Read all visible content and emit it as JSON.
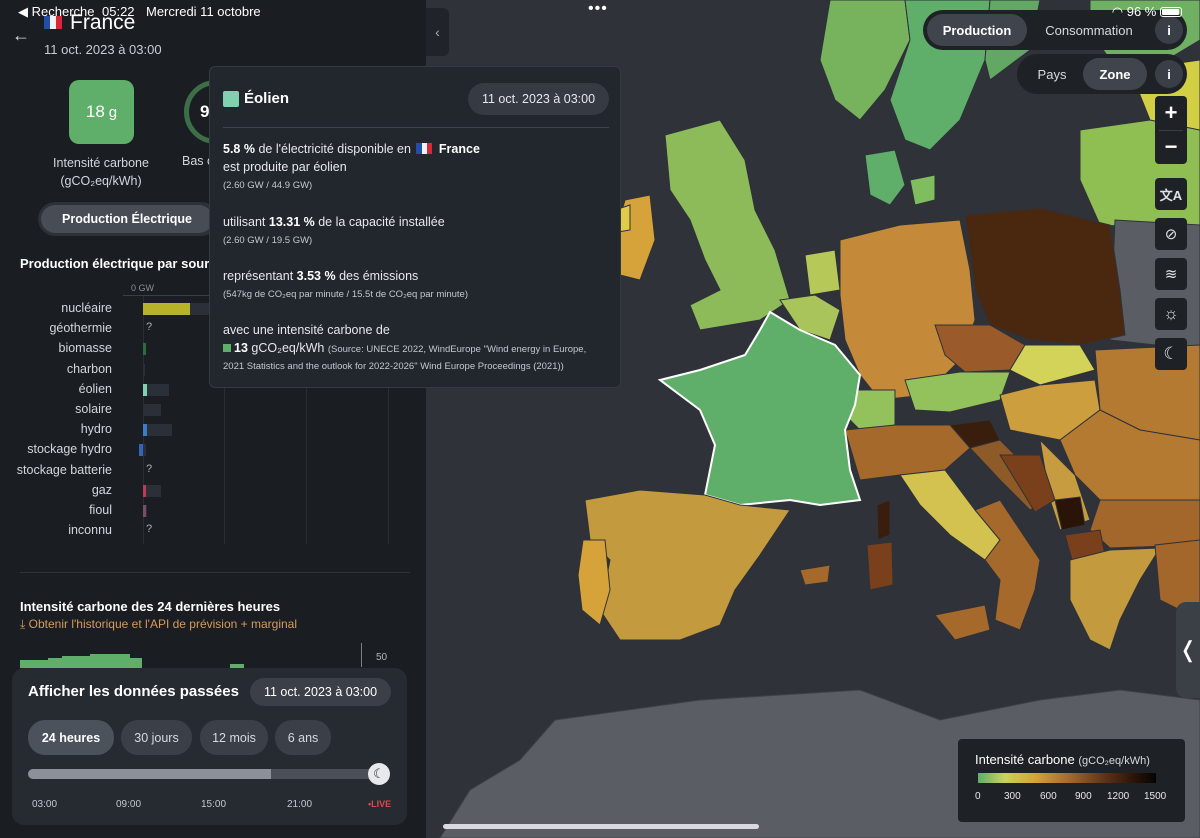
{
  "status_bar": {
    "back_app": "◀ Recherche",
    "time": "05:22",
    "date": "Mercredi 11 octobre",
    "battery": "96 %"
  },
  "panel": {
    "zone_name": "France",
    "zone_datetime": "11 oct. 2023 à 03:00",
    "carbon_intensity": {
      "value": "18",
      "unit": "g",
      "label_line1": "Intensité carbone",
      "label_line2": "(gCO₂eq/kWh)"
    },
    "low_carbon": {
      "value": "9",
      "label": "Bas c"
    },
    "mode_toggle_label": "Production Électrique",
    "production_title": "Production électrique par sour",
    "axis_zero": "0 GW",
    "sources": [
      {
        "name": "nucléaire",
        "value_gw": 35.0,
        "capacity_gw": 61.4,
        "color": "#b6b32b"
      },
      {
        "name": "géothermie",
        "value_gw": null,
        "capacity_gw": null,
        "color": "",
        "unknown": "?"
      },
      {
        "name": "biomasse",
        "value_gw": 0.9,
        "capacity_gw": 2.2,
        "color": "#2f6b3a"
      },
      {
        "name": "charbon",
        "value_gw": 0,
        "capacity_gw": 1.8,
        "color": "#555555"
      },
      {
        "name": "éolien",
        "value_gw": 2.6,
        "capacity_gw": 19.5,
        "color": "#7fd1b0"
      },
      {
        "name": "solaire",
        "value_gw": 0,
        "capacity_gw": 13.7,
        "color": "#e5c53b"
      },
      {
        "name": "hydro",
        "value_gw": 3.0,
        "capacity_gw": 21.5,
        "color": "#3b7cc7"
      },
      {
        "name": "stockage hydro",
        "value_gw": -1.5,
        "capacity_gw": 5.0,
        "color": "#3264b8"
      },
      {
        "name": "stockage batterie",
        "value_gw": null,
        "capacity_gw": null,
        "color": "",
        "unknown": "?"
      },
      {
        "name": "gaz",
        "value_gw": 0.6,
        "capacity_gw": 13.0,
        "color": "#c23a4f"
      },
      {
        "name": "fioul",
        "value_gw": 0.2,
        "capacity_gw": 2.9,
        "color": "#7a4c6b"
      },
      {
        "name": "inconnu",
        "value_gw": null,
        "capacity_gw": null,
        "color": "",
        "unknown": "?"
      }
    ],
    "history_title": "Intensité carbone des 24 dernières heures",
    "history_link": "⤓ Obtenir l'historique et l'API de prévision + marginal",
    "history_axis_value": "50"
  },
  "time_controller": {
    "title": "Afficher les données passées",
    "selected_datetime": "11 oct. 2023 à 03:00",
    "ranges": [
      "24 heures",
      "30 jours",
      "12 mois",
      "6 ans"
    ],
    "active_range": "24 heures",
    "progress": 0.7,
    "ticks": [
      "03:00",
      "09:00",
      "15:00",
      "21:00"
    ],
    "live_label": "•LIVE"
  },
  "tooltip": {
    "title": "Éolien",
    "datetime": "11 oct. 2023 à 03:00",
    "p1_pct": "5.8 %",
    "p1_text_a": "de l'électricité disponible en",
    "p1_country": "France",
    "p1_text_b": "est produite par éolien",
    "p1_small": "(2.60 GW / 44.9 GW)",
    "p2_text_a": "utilisant",
    "p2_pct": "13.31 %",
    "p2_text_b": "de la capacité installée",
    "p2_small": "(2.60 GW / 19.5 GW)",
    "p3_text_a": "représentant",
    "p3_pct": "3.53 %",
    "p3_text_b": "des émissions",
    "p3_small": "(547kg de CO₂eq par minute / 15.5t de CO₂eq par minute)",
    "p4_text": "avec une intensité carbone de",
    "p4_value": "13",
    "p4_unit": "gCO₂eq/kWh",
    "p4_source_a": "(Source: UNECE 2022, WindEurope \"Wind energy in Europe,",
    "p4_source_b": "2021 Statistics and the outlook for 2022-2026\" Wind Europe Proceedings (2021))"
  },
  "map_controls": {
    "view_modes": [
      "Production",
      "Consommation"
    ],
    "active_view_mode": "Production",
    "granularity": [
      "Pays",
      "Zone"
    ],
    "active_granularity": "Zone",
    "info_label": "i",
    "zoom_in": "+",
    "zoom_out": "−",
    "layer_buttons": [
      {
        "name": "language-icon",
        "glyph": "文A"
      },
      {
        "name": "eye-off-icon",
        "glyph": "⊘"
      },
      {
        "name": "wind-icon",
        "glyph": "≋"
      },
      {
        "name": "sun-icon",
        "glyph": "☼"
      },
      {
        "name": "moon-icon",
        "glyph": "☾"
      }
    ],
    "side_handle": "❬"
  },
  "legend": {
    "title": "Intensité carbone",
    "unit": "(gCO₂eq/kWh)",
    "ticks": [
      "0",
      "300",
      "600",
      "900",
      "1200",
      "1500"
    ]
  },
  "map_zone_colors": {
    "water": "#2f3238",
    "land_no_data": "#5a5d63",
    "france": "#5fae6a",
    "poland": "#4a2810",
    "germany": "#c48a3a",
    "uk": "#8dbb5a",
    "spain": "#c39a3e",
    "italy": "#a5692b"
  }
}
